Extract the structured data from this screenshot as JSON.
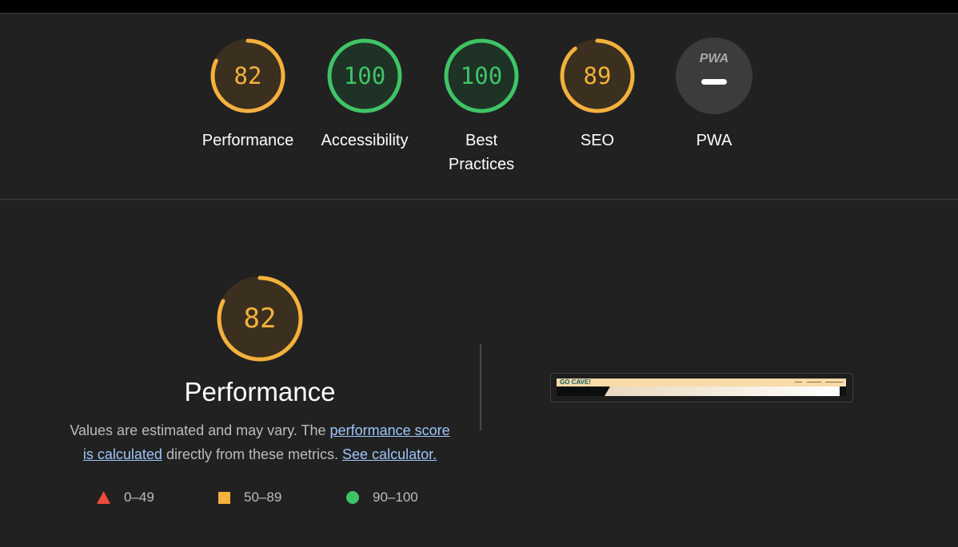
{
  "colors": {
    "average": "#f4b13d",
    "pass": "#3fc466",
    "fail": "#ee4b3a",
    "average_fill": "#3b2f1f",
    "pass_fill": "#1f3226"
  },
  "gauges": [
    {
      "label": "Performance",
      "score": "82",
      "rating": "average",
      "fraction": 0.82
    },
    {
      "label": "Accessibility",
      "score": "100",
      "rating": "pass",
      "fraction": 1.0
    },
    {
      "label": "Best Practices",
      "score": "100",
      "rating": "pass",
      "fraction": 1.0
    },
    {
      "label": "SEO",
      "score": "89",
      "rating": "average",
      "fraction": 0.89
    }
  ],
  "pwa": {
    "label": "PWA",
    "logo_text": "PWA"
  },
  "performance": {
    "score": "82",
    "fraction": 0.82,
    "title": "Performance",
    "desc_prefix": "Values are estimated and may vary. The",
    "score_link": "performance score is calculated",
    "desc_middle": "directly from these metrics.",
    "calculator_link": "See calculator."
  },
  "legend": [
    {
      "icon": "triangle-icon",
      "range": "0–49"
    },
    {
      "icon": "square-icon",
      "range": "50–89"
    },
    {
      "icon": "circle-icon",
      "range": "90–100"
    }
  ],
  "screenshot": {
    "site_logo": "GO CAVE!"
  }
}
